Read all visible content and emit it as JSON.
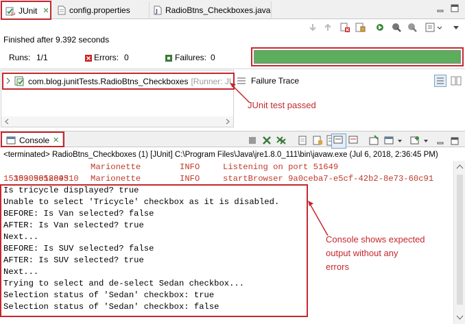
{
  "junit_view": {
    "tabs": [
      {
        "label": "JUnit",
        "icon": "junit-icon",
        "close": "✕"
      },
      {
        "label": "config.properties",
        "icon": "properties-file-icon"
      },
      {
        "label": "RadioBtns_Checkboxes.java",
        "icon": "java-file-icon"
      }
    ],
    "finished_text": "Finished after 9.392 seconds",
    "stats": {
      "runs_label": "Runs:",
      "runs_value": "1/1",
      "errors_label": "Errors:",
      "errors_value": "0",
      "failures_label": "Failures:",
      "failures_value": "0"
    },
    "progress": {
      "fraction": 1.0,
      "color": "#5cad5c"
    },
    "test_tree": {
      "item_name": "com.blog.junitTests.RadioBtns_Checkboxes",
      "item_runner": "[Runner: JU"
    },
    "failure_trace_label": "Failure Trace",
    "annotation": "JUnit test passed"
  },
  "console_view": {
    "tab_label": "Console",
    "header": "<terminated> RadioBtns_Checkboxes (1) [JUnit] C:\\Program Files\\Java\\jre1.8.0_111\\bin\\javaw.exe (Jul 6, 2018, 2:36:45 PM)",
    "log_lines": [
      {
        "ts": "1530905809510",
        "source": "Marionette",
        "level": "INFO",
        "message": "Listening on port 51649"
      },
      {
        "ts": "1530905812843",
        "source": "Marionette",
        "level": "INFO",
        "message": "startBrowser 9a0ceba7-e5cf-42b2-8e73-60c91"
      }
    ],
    "output_lines": [
      "Is tricycle displayed? true",
      "Unable to select 'Tricycle' checkbox as it is disabled.",
      "BEFORE: Is Van selected? false",
      "AFTER: Is Van selected? true",
      "Next...",
      "BEFORE: Is SUV selected? false",
      "AFTER: Is SUV selected? true",
      "Next...",
      "Trying to select and de-select Sedan checkbox...",
      "Selection status of 'Sedan' checkbox: true",
      "Selection status of 'Sedan' checkbox: false"
    ],
    "annotation": [
      "Console shows expected",
      "output without any",
      "errors"
    ]
  },
  "colors": {
    "accent_red": "#c4272d",
    "progress_green": "#5cad5c",
    "log_red": "#c0392b"
  }
}
